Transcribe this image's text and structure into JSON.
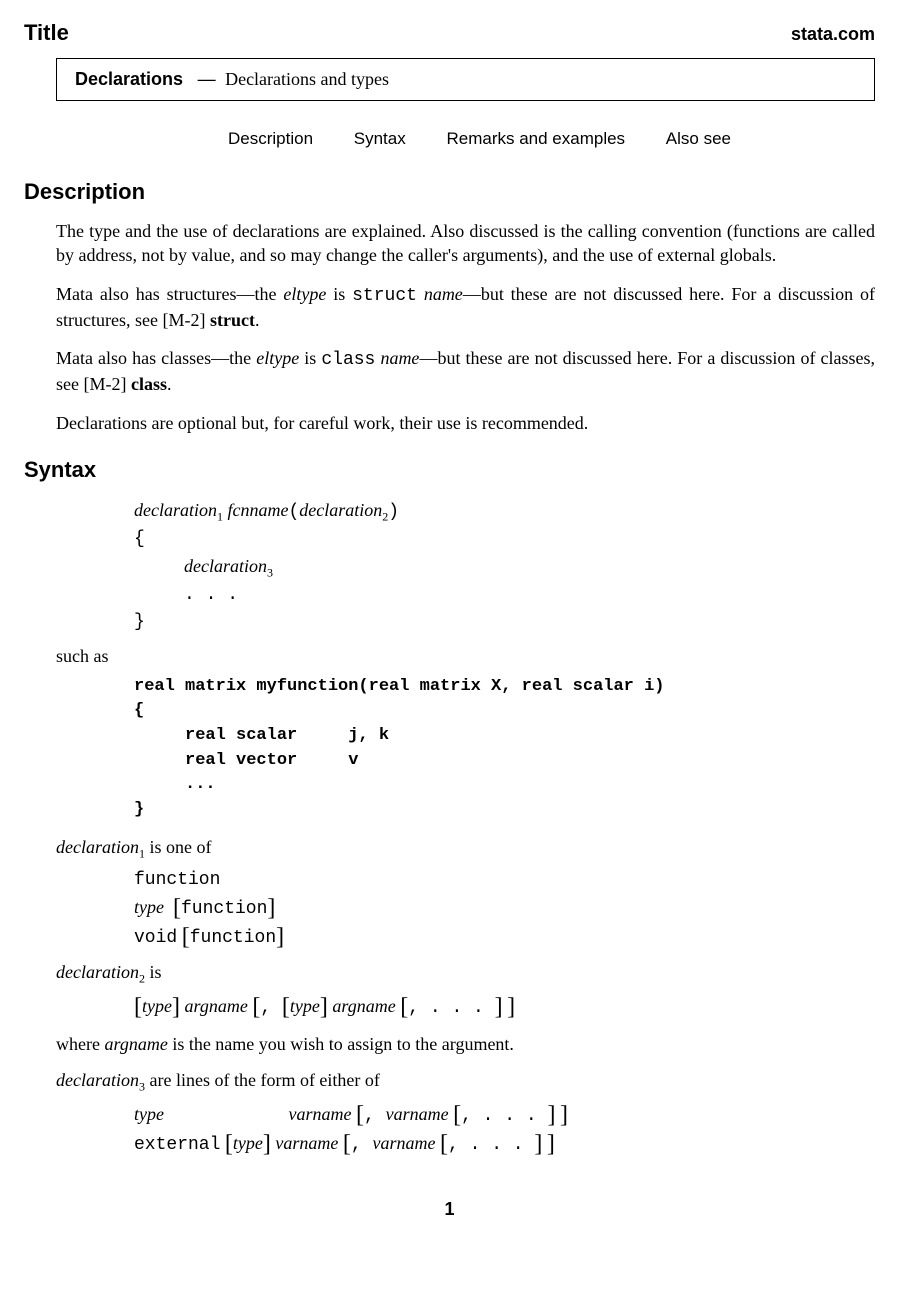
{
  "header": {
    "title": "Title",
    "brand": "stata.com"
  },
  "box": {
    "name": "Declarations",
    "sep": "—",
    "desc": "Declarations and types"
  },
  "nav": {
    "description": "Description",
    "syntax": "Syntax",
    "remarks": "Remarks and examples",
    "also": "Also see"
  },
  "sections": {
    "description": "Description",
    "syntax": "Syntax"
  },
  "desc": {
    "p1": "The type and the use of declarations are explained. Also discussed is the calling convention (functions are called by address, not by value, and so may change the caller's arguments), and the use of external globals.",
    "p2a": "Mata also has structures—the ",
    "p2b": "eltype",
    "p2c": " is ",
    "p2d": "struct",
    "p2e": " ",
    "p2f": "name",
    "p2g": "—but these are not discussed here. For a discussion of structures, see [M-2] ",
    "p2h": "struct",
    "p2i": ".",
    "p3a": "Mata also has classes—the ",
    "p3b": "eltype",
    "p3c": " is ",
    "p3d": "class",
    "p3e": " ",
    "p3f": "name",
    "p3g": "—but these are not discussed here. For a discussion of classes, see [M-2] ",
    "p3h": "class",
    "p3i": ".",
    "p4": "Declarations are optional but, for careful work, their use is recommended."
  },
  "syntax": {
    "line1a": "declaration",
    "line1sub1": "1",
    "line1b": " fcnname",
    "line1c": "(",
    "line1d": "declaration",
    "line1sub2": "2",
    "line1e": ")",
    "brace_open": "{",
    "line3a": "declaration",
    "line3sub": "3",
    "dots": ". . .",
    "brace_close": "}",
    "suchas": "such as",
    "code": "real matrix myfunction(real matrix X, real scalar i)\n{\n     real scalar     j, k\n     real vector     v\n     ...\n}",
    "d1a": "declaration",
    "d1sub": "1",
    "d1b": " is one of",
    "d1_l1": "function",
    "d1_l2a": "type",
    "d1_l2b": "function",
    "d1_l3a": "void",
    "d1_l3b": "function",
    "d2a": "declaration",
    "d2sub": "2",
    "d2b": " is",
    "d2_l1a": "type",
    "d2_l1b": " argname ",
    "d2_l1c": ", ",
    "d2_l1d": "type",
    "d2_l1e": " argname ",
    "d2_l1f": ", . . . ",
    "d2_note_a": "where ",
    "d2_note_b": "argname",
    "d2_note_c": " is the name you wish to assign to the argument.",
    "d3a": "declaration",
    "d3sub": "3",
    "d3b": " are lines of the form of either of",
    "d3_l1a": "type",
    "d3_l1b": "varname ",
    "d3_l1c": ", ",
    "d3_l1d": "varname ",
    "d3_l1e": ", . . . ",
    "d3_l2a": "external",
    "d3_l2b": "type",
    "d3_l2c": " varname ",
    "d3_l2d": ", ",
    "d3_l2e": "varname ",
    "d3_l2f": ", . . . "
  },
  "pagenum": "1"
}
